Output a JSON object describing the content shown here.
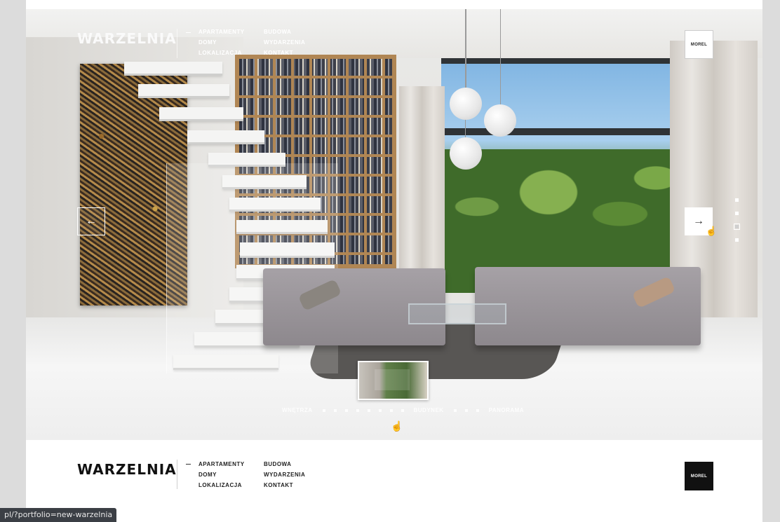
{
  "brand": {
    "logo_text": "WARZELNIA",
    "partner_badge": "MOREL"
  },
  "nav": {
    "col1": [
      "APARTAMENTY",
      "DOMY",
      "LOKALIZACJA"
    ],
    "col2": [
      "BUDOWA",
      "WYDARZENIA",
      "KONTAKT"
    ]
  },
  "slider": {
    "prev_icon": "←",
    "next_icon": "→",
    "side_dots_count": 4,
    "active_side_dot": 2,
    "sections": [
      "WNĘTRZA",
      "BUDYNEK",
      "PANORAMA"
    ]
  },
  "footer": {
    "logo_text": "WARZELNIA",
    "partner_badge": "MOREL",
    "col1": [
      "APARTAMENTY",
      "DOMY",
      "LOKALIZACJA"
    ],
    "col2": [
      "BUDOWA",
      "WYDARZENIA",
      "KONTAKT"
    ]
  },
  "status": {
    "url": "pl/?portfolio=new-warzelnia"
  }
}
